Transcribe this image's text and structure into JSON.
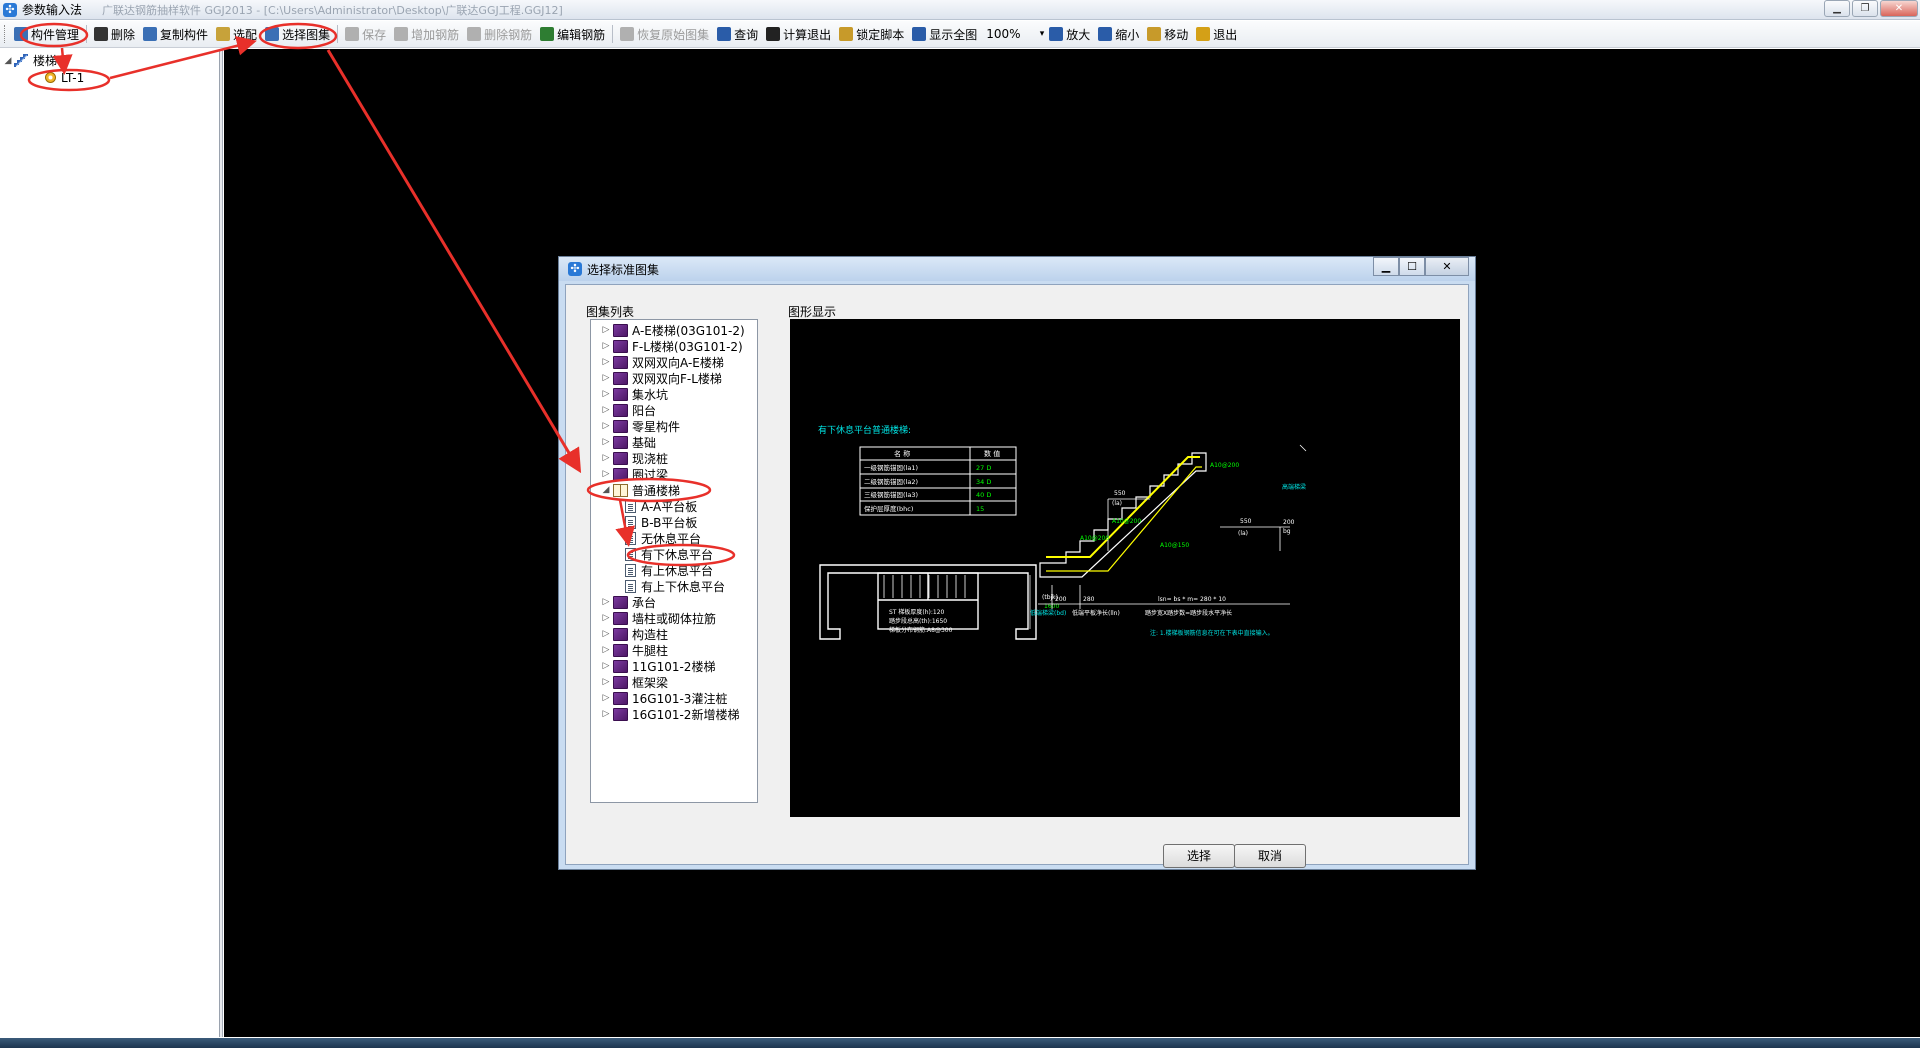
{
  "window": {
    "title": "参数输入法",
    "path": "广联达钢筋抽样软件 GGJ2013 - [C:\\Users\\Administrator\\Desktop\\广联达GGJ工程.GGJ12]"
  },
  "toolbar": {
    "items": [
      {
        "label": "构件管理",
        "icon": "component-manage-icon",
        "enabled": true,
        "color": "#3a6fb5"
      },
      {
        "label": "删除",
        "icon": "delete-icon",
        "enabled": true,
        "color": "#333333"
      },
      {
        "label": "复制构件",
        "icon": "copy-icon",
        "enabled": true,
        "color": "#3a6fb5"
      },
      {
        "label": "选配",
        "icon": "select-config-icon",
        "enabled": true,
        "color": "#c7a23a"
      },
      {
        "label": "选择图集",
        "icon": "select-atlas-icon",
        "enabled": true,
        "color": "#3a6fb5"
      },
      {
        "label": "保存",
        "icon": "save-icon",
        "enabled": false,
        "color": "#b0b0b0"
      },
      {
        "label": "增加钢筋",
        "icon": "add-rebar-icon",
        "enabled": false,
        "color": "#b0b0b0"
      },
      {
        "label": "删除钢筋",
        "icon": "delete-rebar-icon",
        "enabled": false,
        "color": "#b0b0b0"
      },
      {
        "label": "编辑钢筋",
        "icon": "edit-rebar-icon",
        "enabled": true,
        "color": "#2e7d32"
      },
      {
        "label": "恢复原始图集",
        "icon": "restore-atlas-icon",
        "enabled": false,
        "color": "#b0b0b0"
      },
      {
        "label": "查询",
        "icon": "query-icon",
        "enabled": true,
        "color": "#2a5ca8"
      },
      {
        "label": "计算退出",
        "icon": "calc-exit-icon",
        "enabled": true,
        "color": "#222222"
      },
      {
        "label": "锁定脚本",
        "icon": "lock-script-icon",
        "enabled": true,
        "color": "#c79a2a"
      },
      {
        "label": "显示全图",
        "icon": "show-all-icon",
        "enabled": true,
        "color": "#2a5ca8"
      }
    ],
    "zoom_value": "100%",
    "items2": [
      {
        "label": "放大",
        "icon": "zoom-in-icon",
        "enabled": true,
        "color": "#2a5ca8"
      },
      {
        "label": "缩小",
        "icon": "zoom-out-icon",
        "enabled": true,
        "color": "#2a5ca8"
      },
      {
        "label": "移动",
        "icon": "move-icon",
        "enabled": true,
        "color": "#c79a2a"
      },
      {
        "label": "退出",
        "icon": "exit-icon",
        "enabled": true,
        "color": "#d4a017"
      }
    ]
  },
  "left_tree": {
    "root": "楼梯",
    "child": "LT-1"
  },
  "dialog": {
    "title": "选择标准图集",
    "list_label": "图集列表",
    "preview_label": "图形显示",
    "select_button": "选择",
    "cancel_button": "取消",
    "atlas_list": [
      {
        "label": "A-E楼梯(03G101-2)",
        "level": 0,
        "type": "book",
        "expander": "▷"
      },
      {
        "label": "F-L楼梯(03G101-2)",
        "level": 0,
        "type": "book",
        "expander": "▷"
      },
      {
        "label": "双网双向A-E楼梯",
        "level": 0,
        "type": "book",
        "expander": "▷"
      },
      {
        "label": "双网双向F-L楼梯",
        "level": 0,
        "type": "book",
        "expander": "▷"
      },
      {
        "label": "集水坑",
        "level": 0,
        "type": "book",
        "expander": "▷"
      },
      {
        "label": "阳台",
        "level": 0,
        "type": "book",
        "expander": "▷"
      },
      {
        "label": "零星构件",
        "level": 0,
        "type": "book",
        "expander": "▷"
      },
      {
        "label": "基础",
        "level": 0,
        "type": "book",
        "expander": "▷"
      },
      {
        "label": "现浇桩",
        "level": 0,
        "type": "book",
        "expander": "▷"
      },
      {
        "label": "圈过梁",
        "level": 0,
        "type": "book",
        "expander": "▷"
      },
      {
        "label": "普通楼梯",
        "level": 0,
        "type": "open",
        "expander": "◢"
      },
      {
        "label": "A-A平台板",
        "level": 1,
        "type": "doc",
        "expander": ""
      },
      {
        "label": "B-B平台板",
        "level": 1,
        "type": "doc",
        "expander": ""
      },
      {
        "label": "无休息平台",
        "level": 1,
        "type": "doc",
        "expander": ""
      },
      {
        "label": "有下休息平台",
        "level": 1,
        "type": "doc",
        "expander": ""
      },
      {
        "label": "有上休息平台",
        "level": 1,
        "type": "doc",
        "expander": ""
      },
      {
        "label": "有上下休息平台",
        "level": 1,
        "type": "doc",
        "expander": ""
      },
      {
        "label": "承台",
        "level": 0,
        "type": "book",
        "expander": "▷"
      },
      {
        "label": "墙柱或砌体拉筋",
        "level": 0,
        "type": "book",
        "expander": "▷"
      },
      {
        "label": "构造柱",
        "level": 0,
        "type": "book",
        "expander": "▷"
      },
      {
        "label": "牛腿柱",
        "level": 0,
        "type": "book",
        "expander": "▷"
      },
      {
        "label": "11G101-2楼梯",
        "level": 0,
        "type": "book",
        "expander": "▷"
      },
      {
        "label": "框架梁",
        "level": 0,
        "type": "book",
        "expander": "▷"
      },
      {
        "label": "16G101-3灌注桩",
        "level": 0,
        "type": "book",
        "expander": "▷"
      },
      {
        "label": "16G101-2新增楼梯",
        "level": 0,
        "type": "book",
        "expander": "▷"
      }
    ]
  },
  "drawing": {
    "heading": "有下休息平台普通楼梯:",
    "table_header": [
      "名 称",
      "数 值"
    ],
    "table_rows": [
      [
        "一级钢筋锚固(la1)",
        "27 D"
      ],
      [
        "二级钢筋锚固(la2)",
        "34 D"
      ],
      [
        "三级钢筋锚固(la3)",
        "40 D"
      ],
      [
        "保护层厚度(bhc)",
        "15"
      ]
    ],
    "plan_notes": [
      "ST 梯板厚度(h):120",
      "踏步段总高(th):1650",
      "梯板分布钢筋:A8@300"
    ],
    "plan_dim": "(tbjk)",
    "plan_dim_val": "1600",
    "rebar_labels": [
      "A10@200",
      "A10@200",
      "A10@200",
      "A10@150",
      "A10@200"
    ],
    "dim_550": "550",
    "dim_la": "(la)",
    "dim_550b": "550",
    "dim_lab": "(la)",
    "dim_200": "200",
    "dim_bg": "bg",
    "dim_200a": "200",
    "dim_280": "280",
    "dim_formula": "lsn= bs * m= 280 * 10",
    "bottom_labels": [
      "低端梯梁(bd)",
      "低端平板净长(lln)",
      "踏步宽X踏步数=踏步段水平净长"
    ],
    "high_beam": "高端梯梁",
    "note": "注: 1.楼梯板钢筋信息在可在下表中直接输入。"
  }
}
